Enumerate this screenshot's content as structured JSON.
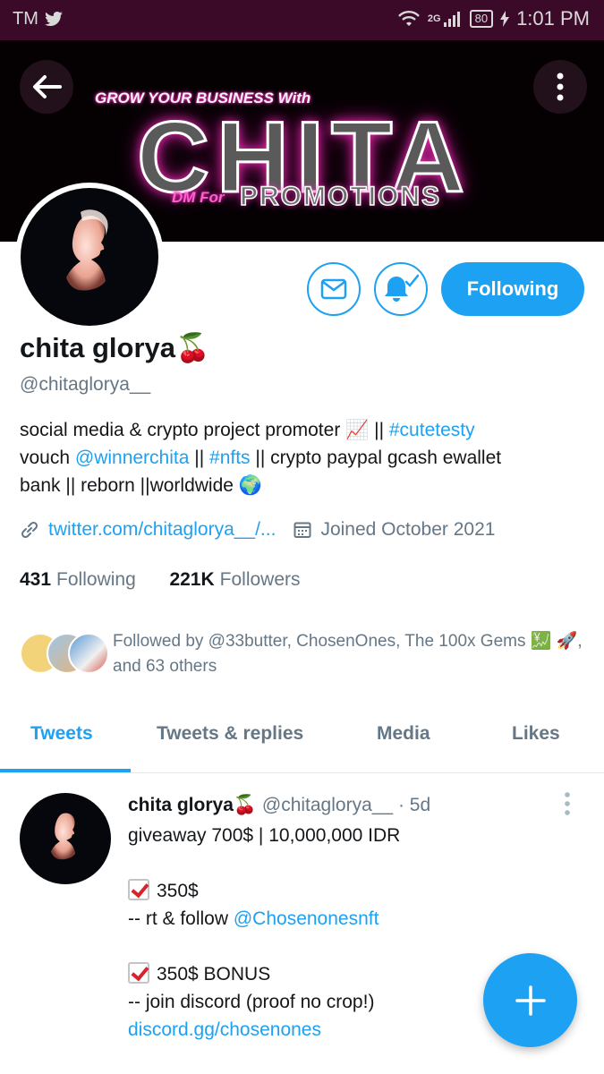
{
  "status_bar": {
    "carrier": "TM",
    "network": "2G",
    "battery": "80",
    "time": "1:01 PM"
  },
  "banner": {
    "line1": "GROW YOUR BUSINESS With",
    "brand": "CHITA",
    "dm": "DM For",
    "promotions": "PROMOTIONS"
  },
  "profile": {
    "name": "chita glorya",
    "name_emoji": "🍒",
    "handle": "@chitaglorya__",
    "bio": {
      "line1_text": "social media & crypto project promoter 📈 || ",
      "line1_link": "#cutetesty",
      "line2_text1": "vouch ",
      "line2_link1": "@winnerchita",
      "line2_text2": " || ",
      "line2_link2": "#nfts",
      "line2_text3": " || crypto paypal gcash ewallet",
      "line3_text": "bank || reborn ||worldwide 🌍"
    },
    "url": "twitter.com/chitaglorya__/...",
    "joined": "Joined October 2021",
    "following_count": "431",
    "following_label": "Following",
    "followers_count": "221K",
    "followers_label": "Followers",
    "followed_by": "Followed by @33butter, ChosenOnes, The 100x Gems 💹 🚀, and 63 others",
    "following_button": "Following"
  },
  "tabs": [
    {
      "label": "Tweets",
      "active": true
    },
    {
      "label": "Tweets & replies",
      "active": false
    },
    {
      "label": "Media",
      "active": false
    },
    {
      "label": "Likes",
      "active": false
    }
  ],
  "tweet": {
    "author": "chita glorya🍒",
    "handle": "@chitaglorya__",
    "time": "· 5d",
    "line1": "giveaway 700$ | 10,000,000 IDR",
    "item1": "350$",
    "item1_detail_text": "-- rt & follow ",
    "item1_detail_link": "@Chosenonesnft",
    "item2": "350$ BONUS",
    "item2_detail": "-- join discord (proof no crop!)",
    "item2_link": "discord.gg/chosenones"
  },
  "icons": {
    "back": "arrow-left-icon",
    "more": "more-vertical-icon",
    "message": "mail-icon",
    "bell": "bell-check-icon",
    "link": "link-icon",
    "calendar": "calendar-icon",
    "compose": "plus-icon"
  },
  "colors": {
    "accent": "#1da1f2",
    "status_bar": "#3a0a28",
    "banner_glow": "#ff2fbf",
    "muted_text": "#657786"
  }
}
